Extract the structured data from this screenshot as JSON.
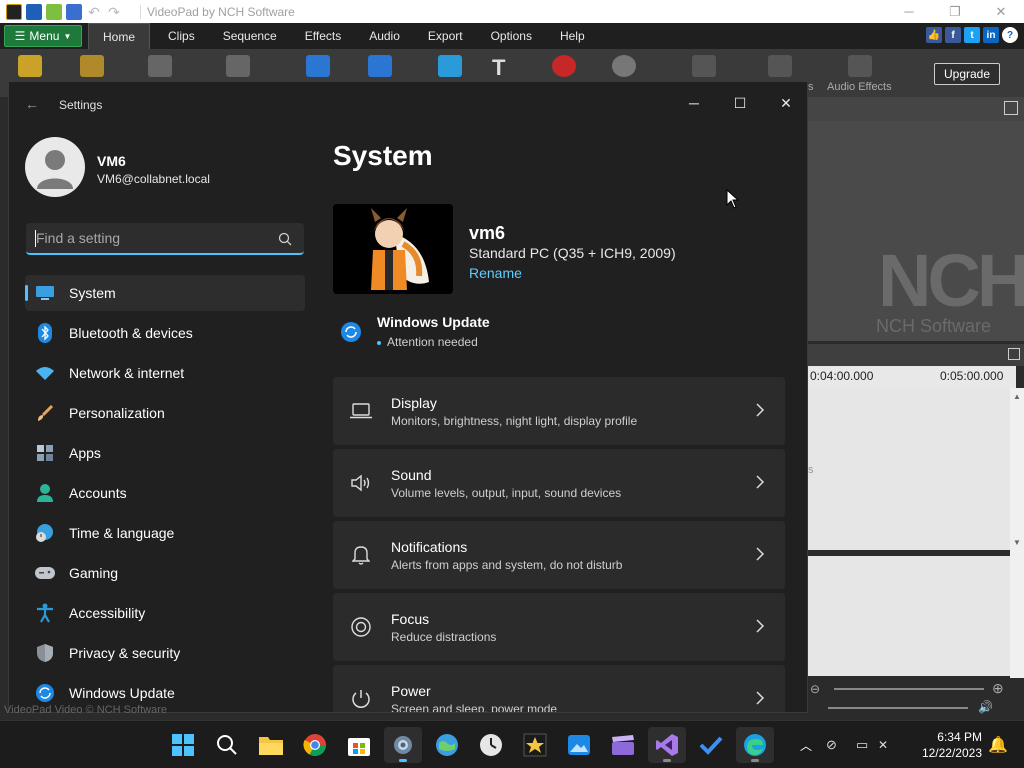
{
  "background_app": {
    "title": "VideoPad by NCH Software",
    "menu_button": "Menu",
    "tabs": [
      "Home",
      "Clips",
      "Sequence",
      "Effects",
      "Audio",
      "Export",
      "Options",
      "Help"
    ],
    "toolbar_labels": {
      "audio_effects": "Audio Effects",
      "partial": "s"
    },
    "upgrade_label": "Upgrade",
    "logo_text": "NCH",
    "logo_sub": "NCH Software",
    "ruler_times": [
      "0:04:00.000",
      "0:05:00.000"
    ],
    "footer_partial": "VideoPad Video © NCH Software",
    "track_partial": "s"
  },
  "settings": {
    "window_title": "Settings",
    "profile": {
      "name": "VM6",
      "email": "VM6@collabnet.local"
    },
    "search": {
      "placeholder": "Find a setting"
    },
    "nav": [
      {
        "label": "System",
        "icon": "monitor-icon",
        "selected": true
      },
      {
        "label": "Bluetooth & devices",
        "icon": "bluetooth-icon"
      },
      {
        "label": "Network & internet",
        "icon": "wifi-icon"
      },
      {
        "label": "Personalization",
        "icon": "brush-icon"
      },
      {
        "label": "Apps",
        "icon": "apps-icon"
      },
      {
        "label": "Accounts",
        "icon": "person-icon"
      },
      {
        "label": "Time & language",
        "icon": "globe-clock-icon"
      },
      {
        "label": "Gaming",
        "icon": "gamepad-icon"
      },
      {
        "label": "Accessibility",
        "icon": "accessibility-icon"
      },
      {
        "label": "Privacy & security",
        "icon": "shield-icon"
      },
      {
        "label": "Windows Update",
        "icon": "update-icon"
      }
    ],
    "page_title": "System",
    "device": {
      "name": "vm6",
      "model": "Standard PC (Q35 + ICH9, 2009)",
      "rename": "Rename"
    },
    "windows_update": {
      "title": "Windows Update",
      "status": "Attention needed"
    },
    "cards": [
      {
        "title": "Display",
        "desc": "Monitors, brightness, night light, display profile",
        "icon": "laptop-icon"
      },
      {
        "title": "Sound",
        "desc": "Volume levels, output, input, sound devices",
        "icon": "speaker-icon"
      },
      {
        "title": "Notifications",
        "desc": "Alerts from apps and system, do not disturb",
        "icon": "bell-icon"
      },
      {
        "title": "Focus",
        "desc": "Reduce distractions",
        "icon": "focus-icon"
      },
      {
        "title": "Power",
        "desc": "Screen and sleep, power mode",
        "icon": "power-icon"
      }
    ]
  },
  "taskbar": {
    "apps": [
      "start-icon",
      "search-icon",
      "file-explorer-icon",
      "chrome-icon",
      "store-icon",
      "settings-icon",
      "globe-app-icon",
      "clock-app-icon",
      "videopad-icon",
      "photos-icon",
      "clapper-icon",
      "visual-studio-icon",
      "todo-icon",
      "edge-icon"
    ],
    "time": "6:34 PM",
    "date": "12/22/2023"
  },
  "colors": {
    "accent": "#4cc2ff",
    "link": "#60cdff",
    "window_bg": "#202020",
    "card_bg": "#2b2b2b"
  }
}
